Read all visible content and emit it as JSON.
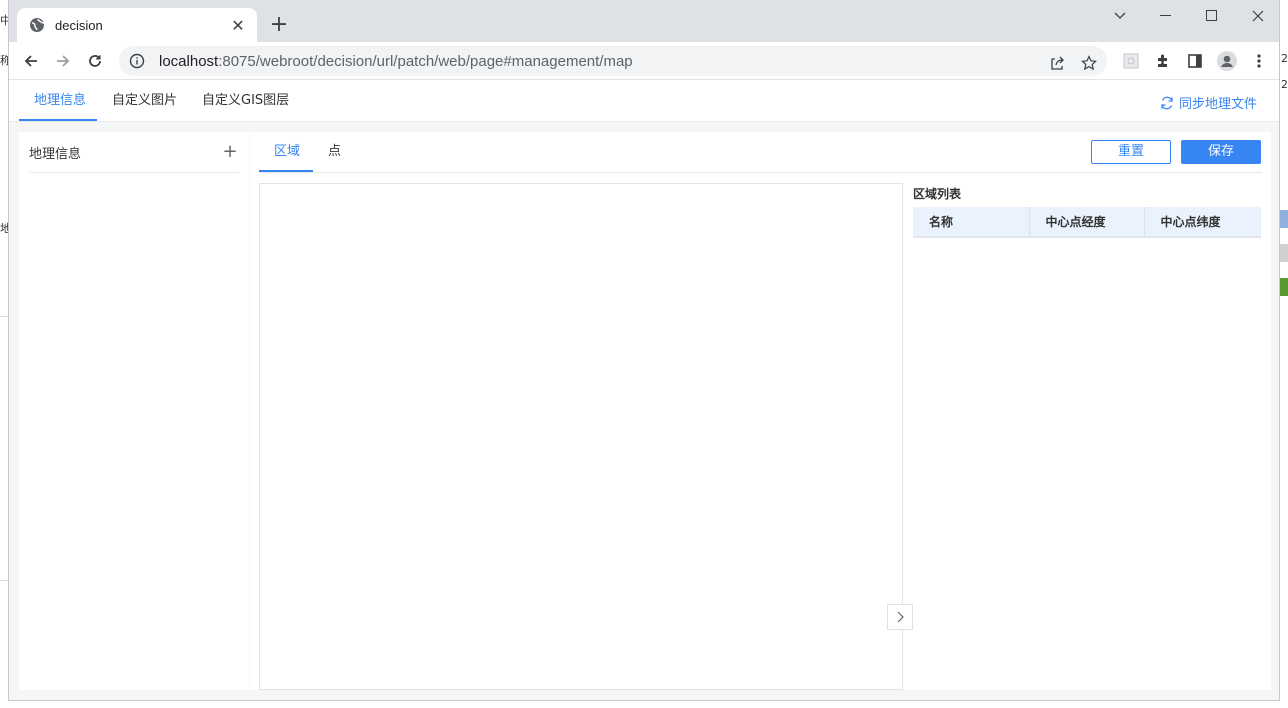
{
  "background": {
    "left_fragments": [
      "中",
      "称",
      "地"
    ],
    "right_fragments": [
      "2",
      "2"
    ],
    "right_block_colors": [
      "#8fb0dc",
      "#d0d0d0",
      "#5b9a2e"
    ]
  },
  "browser": {
    "tab": {
      "title": "decision",
      "close_icon": "close-icon",
      "favicon": "globe-icon"
    },
    "new_tab_label": "+",
    "url": {
      "host": "localhost",
      "rest": ":8075/webroot/decision/url/patch/web/page#management/map"
    }
  },
  "app": {
    "top_tabs": [
      {
        "label": "地理信息",
        "active": true
      },
      {
        "label": "自定义图片",
        "active": false
      },
      {
        "label": "自定义GIS图层",
        "active": false
      }
    ],
    "sync_label": "同步地理文件",
    "left_panel": {
      "title": "地理信息",
      "add_label": "+"
    },
    "sub_tabs": [
      {
        "label": "区域",
        "active": true
      },
      {
        "label": "点",
        "active": false
      }
    ],
    "reset_label": "重置",
    "save_label": "保存",
    "region_list": {
      "title": "区域列表",
      "columns": [
        "名称",
        "中心点经度",
        "中心点纬度"
      ],
      "rows": []
    },
    "accent_color": "#3685f2"
  }
}
